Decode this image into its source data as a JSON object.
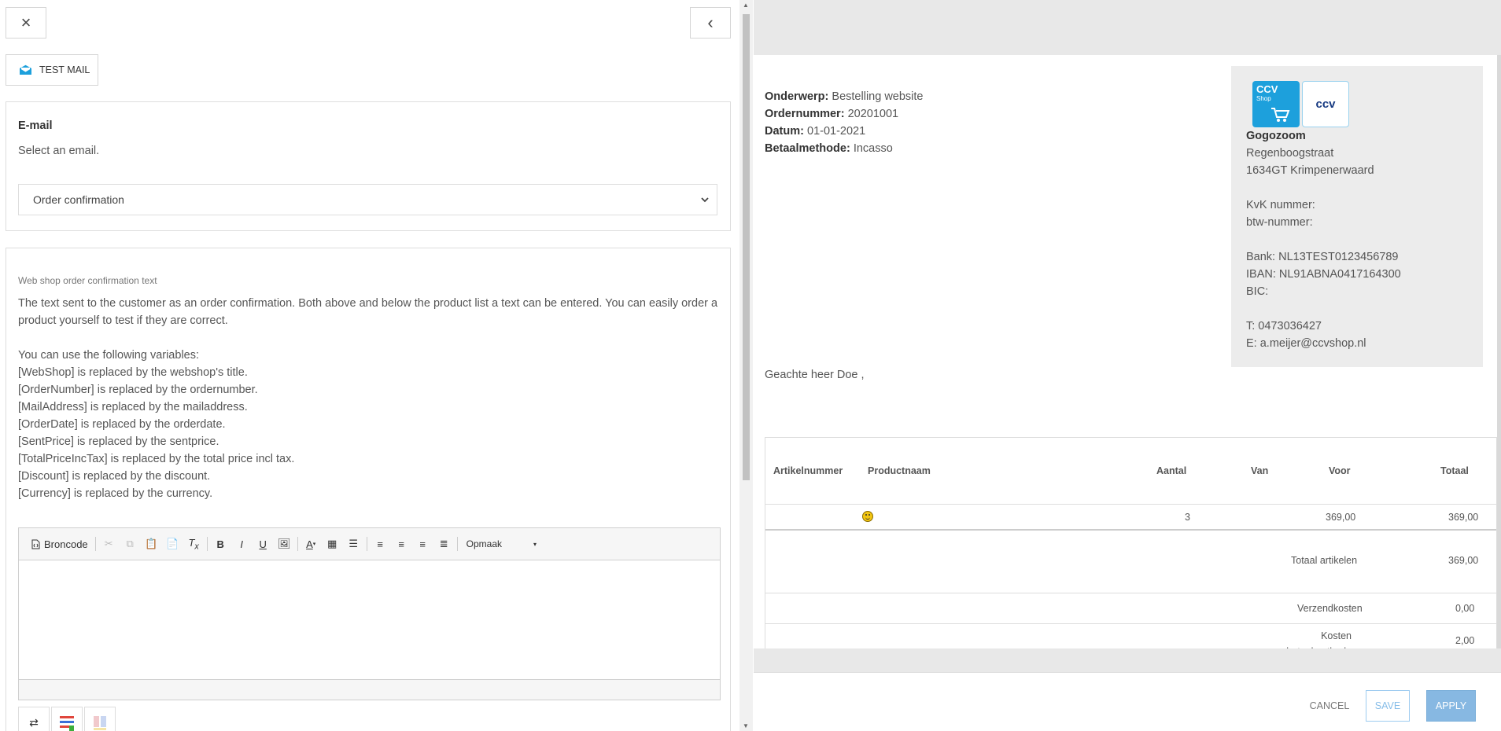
{
  "left": {
    "close_icon": "×",
    "collapse_icon": "‹",
    "test_mail_label": "TEST MAIL",
    "email_card": {
      "title": "E-mail",
      "subtitle": "Select an email.",
      "selected": "Order confirmation"
    },
    "text_card": {
      "title": "Web shop order confirmation text",
      "description": "The text sent to the customer as an order confirmation. Both above and below the product list a text can be entered. You can easily order a product yourself to test if they are correct.",
      "variables_intro": "You can use the following variables:",
      "variables": [
        "[WebShop] is replaced by the webshop's title.",
        "[OrderNumber] is replaced by the ordernumber.",
        "[MailAddress] is replaced by the mailaddress.",
        "[OrderDate] is replaced by the orderdate.",
        "[SentPrice] is replaced by the sentprice.",
        "[TotalPriceIncTax] is replaced by the total price incl tax.",
        "[Discount] is replaced by the discount.",
        "[Currency] is replaced by the currency."
      ]
    },
    "editor": {
      "source_label": "Broncode",
      "format_label": "Opmaak"
    }
  },
  "preview": {
    "meta": [
      {
        "label": "Onderwerp",
        "value": "Bestelling website"
      },
      {
        "label": "Ordernummer",
        "value": "20201001"
      },
      {
        "label": "Datum",
        "value": "01-01-2021"
      },
      {
        "label": "Betaalmethode",
        "value": "Incasso"
      }
    ],
    "logo_left_title": "CCV",
    "logo_left_sub": "Shop",
    "logo_right": "ccv",
    "company": {
      "name": "Gogozoom",
      "street": "Regenboogstraat",
      "city": "1634GT Krimpenerwaard",
      "kvk": "KvK nummer:",
      "btw": "btw-nummer:",
      "bank": "Bank: NL13TEST0123456789",
      "iban": "IBAN: NL91ABNA0417164300",
      "bic": "BIC:",
      "phone": "T: 0473036427",
      "email": "E: a.meijer@ccvshop.nl"
    },
    "greeting": "Geachte heer Doe ,",
    "table": {
      "headers": {
        "article_no": "Artikelnummer",
        "product": "Productnaam",
        "qty": "Aantal",
        "from": "Van",
        "for": "Voor",
        "total": "Totaal"
      },
      "row": {
        "qty": "3",
        "for": "369,00",
        "total": "369,00"
      },
      "totals": [
        {
          "label": "Totaal artikelen",
          "value": "369,00"
        },
        {
          "label": "Verzendkosten",
          "value": "0,00"
        },
        {
          "label": "Kosten betaalmethode",
          "value": "2,00"
        }
      ]
    }
  },
  "footer": {
    "cancel": "CANCEL",
    "save": "SAVE",
    "apply": "APPLY"
  },
  "colors": {
    "accent_blue": "#1da0dc",
    "apply_bg": "#87b8e2",
    "save_border": "#9ecbf0"
  }
}
